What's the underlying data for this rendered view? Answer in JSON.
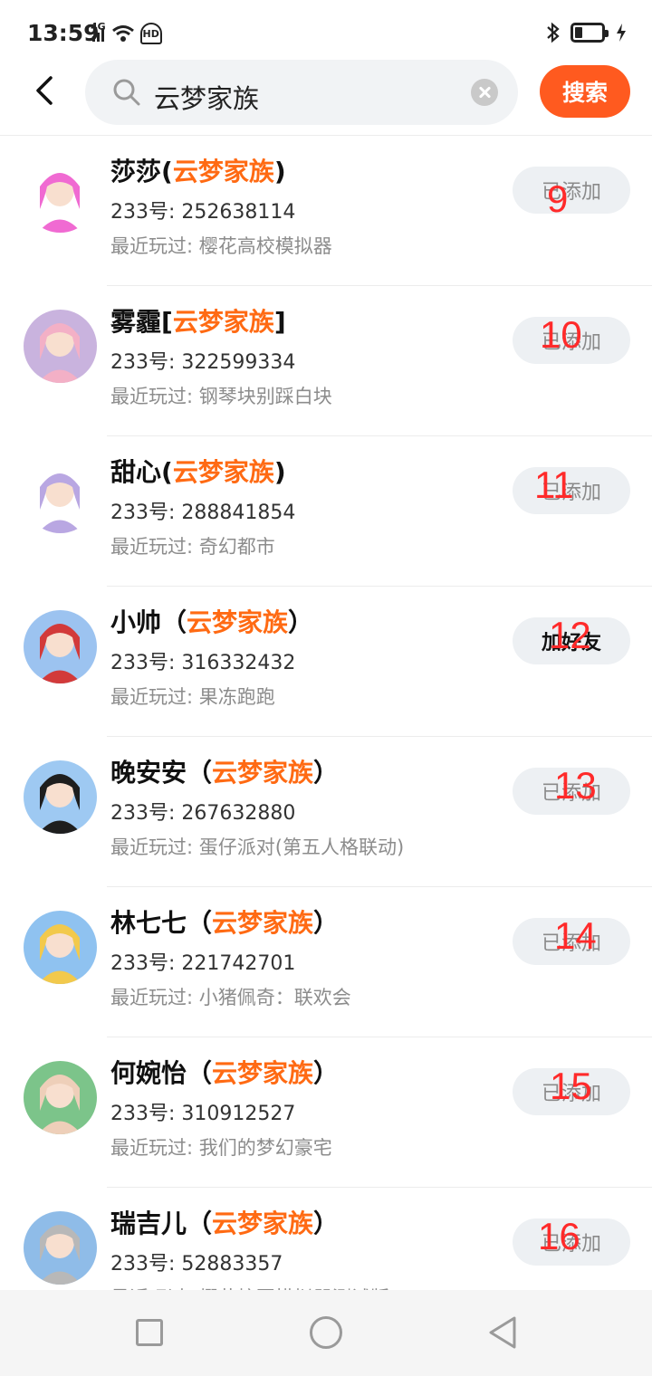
{
  "status_bar": {
    "time": "13:59",
    "network_label": "4G",
    "hd_label": "HD",
    "icons": [
      "signal-icon",
      "wifi-icon",
      "hd-icon",
      "bluetooth-icon",
      "battery-icon",
      "charging-icon"
    ]
  },
  "header": {
    "search_query": "云梦家族",
    "search_button": "搜索"
  },
  "labels": {
    "id_prefix": "233号: ",
    "recent_prefix": "最近玩过: "
  },
  "users": [
    {
      "name": "莎莎(",
      "family": "云梦家族",
      "suffix": ")",
      "id": "252638114",
      "recent": "樱花高校模拟器",
      "action": "已添加",
      "badge": "9",
      "avatar_bg": "#ffffff",
      "accent": "#f06ad2"
    },
    {
      "name": "雾霾[",
      "family": "云梦家族",
      "suffix": "]",
      "id": "322599334",
      "recent": "钢琴块别踩白块",
      "action": "已添加",
      "badge": "10",
      "avatar_bg": "#c9b3de",
      "accent": "#f3b0c6"
    },
    {
      "name": "甜心(",
      "family": "云梦家族",
      "suffix": ")",
      "id": "288841854",
      "recent": "奇幻都市",
      "action": "已添加",
      "badge": "11",
      "avatar_bg": "#ffffff",
      "accent": "#b9a7e2"
    },
    {
      "name": "小帅（",
      "family": "云梦家族",
      "suffix": "）",
      "id": "316332432",
      "recent": "果冻跑跑",
      "action": "加好友",
      "badge": "12",
      "avatar_bg": "#9cc3f0",
      "accent": "#d23a3a"
    },
    {
      "name": "晚安安（",
      "family": "云梦家族",
      "suffix": "）",
      "id": "267632880",
      "recent": "蛋仔派对(第五人格联动)",
      "action": "已添加",
      "badge": "13",
      "avatar_bg": "#9ec9f2",
      "accent": "#1e1e1e"
    },
    {
      "name": "林七七（",
      "family": "云梦家族",
      "suffix": "）",
      "id": "221742701",
      "recent": "小猪佩奇：联欢会",
      "action": "已添加",
      "badge": "14",
      "avatar_bg": "#8fc2f0",
      "accent": "#f2c94c"
    },
    {
      "name": "何婉怡（",
      "family": "云梦家族",
      "suffix": "）",
      "id": "310912527",
      "recent": "我们的梦幻豪宅",
      "action": "已添加",
      "badge": "15",
      "avatar_bg": "#7cc48a",
      "accent": "#eecfb9"
    },
    {
      "name": "瑞吉儿（",
      "family": "云梦家族",
      "suffix": "）",
      "id": "52883357",
      "recent": "樱花校园模拟器测试版",
      "action": "已添加",
      "badge": "16",
      "avatar_bg": "#8fbce8",
      "accent": "#b8b8b8"
    }
  ],
  "nav": {
    "icons": [
      "recent-apps-icon",
      "home-icon",
      "back-icon"
    ]
  }
}
